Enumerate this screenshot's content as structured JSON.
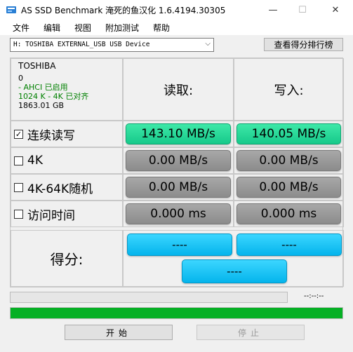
{
  "window": {
    "title": "AS SSD Benchmark 淹死的鱼汉化 1.6.4194.30305",
    "minimize": "—",
    "maximize": "☐",
    "close": "✕"
  },
  "menu": [
    "文件",
    "编辑",
    "视图",
    "附加测试",
    "帮助"
  ],
  "device": {
    "selected": "H: TOSHIBA EXTERNAL_USB USB Device",
    "rank_button": "查看得分排行榜"
  },
  "info": {
    "name": "TOSHIBA",
    "id": "0",
    "ahci": "- AHCI 已启用",
    "align": "1024 K - 4K 已对齐",
    "size": "1863.01 GB"
  },
  "headers": {
    "read": "读取:",
    "write": "写入:"
  },
  "rows": [
    {
      "label": "连续读写",
      "checked": true,
      "read": "143.10 MB/s",
      "write": "140.05 MB/s"
    },
    {
      "label": "4K",
      "checked": false,
      "read": "0.00 MB/s",
      "write": "0.00 MB/s"
    },
    {
      "label": "4K-64K随机",
      "checked": false,
      "read": "0.00 MB/s",
      "write": "0.00 MB/s"
    },
    {
      "label": "访问时间",
      "checked": false,
      "read": "0.000 ms",
      "write": "0.000 ms"
    }
  ],
  "score": {
    "label": "得分:",
    "read": "----",
    "write": "----",
    "total": "----"
  },
  "progress": {
    "time": "--:--:--",
    "overall": 1.0
  },
  "buttons": {
    "start": "开始",
    "stop": "停止"
  },
  "colors": {
    "green": "#16c98a",
    "gray": "#8c8c8c",
    "blue": "#04b4ec",
    "progress": "#06b025"
  }
}
